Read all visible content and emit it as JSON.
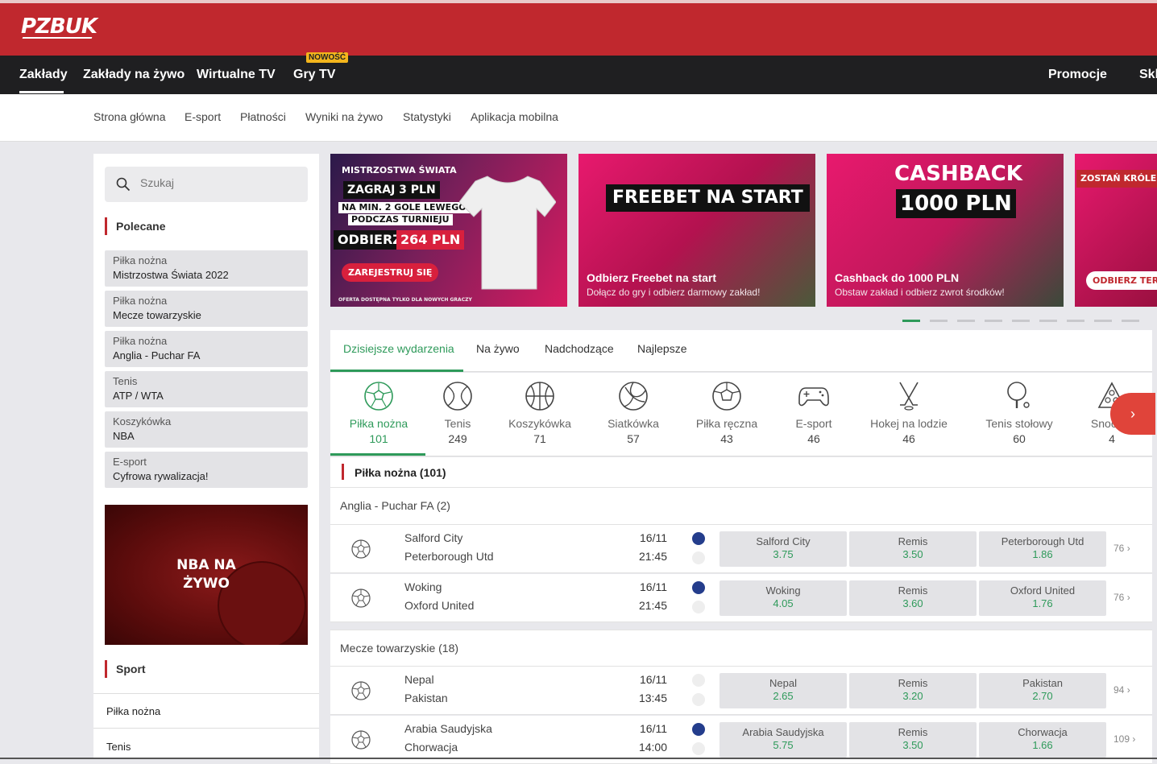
{
  "brand": {
    "logo": "PZBUK",
    "accent": "#c0282e",
    "green": "#2e9a5a"
  },
  "nav": {
    "items": [
      "Zakłady",
      "Zakłady na żywo",
      "Wirtualne TV",
      "Gry TV",
      "Promocje",
      "Skl"
    ],
    "badge": "NOWOŚĆ"
  },
  "subnav": [
    "Strona główna",
    "E-sport",
    "Płatności",
    "Wyniki na żywo",
    "Statystyki",
    "Aplikacja mobilna"
  ],
  "sidebar": {
    "search_placeholder": "Szukaj",
    "recommended_title": "Polecane",
    "recommended": [
      {
        "category": "Piłka nożna",
        "name": "Mistrzostwa Świata 2022"
      },
      {
        "category": "Piłka nożna",
        "name": "Mecze towarzyskie"
      },
      {
        "category": "Piłka nożna",
        "name": "Anglia - Puchar FA"
      },
      {
        "category": "Tenis",
        "name": "ATP / WTA"
      },
      {
        "category": "Koszykówka",
        "name": "NBA"
      },
      {
        "category": "E-sport",
        "name": "Cyfrowa rywalizacja!"
      }
    ],
    "promo_text": "NBA NA ŻYWO",
    "sport_title": "Sport",
    "sport_items": [
      "Piłka nożna",
      "Tenis"
    ]
  },
  "banners": [
    {
      "kicker": "MISTRZOSTWA ŚWIATA",
      "line1": "ZAGRAJ 3 PLN",
      "line2": "NA MIN. 2 GOLE LEWEGO",
      "line3": "PODCZAS TURNIEJU",
      "line4a": "ODBIERZ",
      "line4b": "264 PLN",
      "cta": "ZAREJESTRUJ SIĘ",
      "fine": "OFERTA DOSTĘPNA TYLKO DLA NOWYCH GRACZY"
    },
    {
      "headline": "FREEBET NA START",
      "title": "Odbierz Freebet na start",
      "subtitle": "Dołącz do gry i odbierz darmowy zakład!"
    },
    {
      "headline1": "CASHBACK",
      "headline2": "1000 PLN",
      "title": "Cashback do 1000 PLN",
      "subtitle": "Obstaw zakład i odbierz zwrot środków!"
    },
    {
      "headline": "ZOSTAŃ KRÓLEM",
      "cta": "ODBIERZ TERAZ"
    }
  ],
  "tabs": [
    "Dzisiejsze wydarzenia",
    "Na żywo",
    "Nadchodzące",
    "Najlepsze"
  ],
  "sports": [
    {
      "name": "Piłka nożna",
      "count": "101"
    },
    {
      "name": "Tenis",
      "count": "249"
    },
    {
      "name": "Koszykówka",
      "count": "71"
    },
    {
      "name": "Siatkówka",
      "count": "57"
    },
    {
      "name": "Piłka ręczna",
      "count": "43"
    },
    {
      "name": "E-sport",
      "count": "46"
    },
    {
      "name": "Hokej na lodzie",
      "count": "46"
    },
    {
      "name": "Tenis stołowy",
      "count": "60"
    },
    {
      "name": "Snooker",
      "count": "4"
    }
  ],
  "section_title": "Piłka nożna  (101)",
  "leagues": [
    {
      "name": "Anglia - Puchar FA (2)"
    },
    {
      "name": "Mecze towarzyskie (18)"
    }
  ],
  "matches": [
    {
      "home": "Salford City",
      "away": "Peterborough Utd",
      "date": "16/11",
      "time": "21:45",
      "stats": true,
      "odds": [
        {
          "label": "Salford City",
          "value": "3.75"
        },
        {
          "label": "Remis",
          "value": "3.50"
        },
        {
          "label": "Peterborough Utd",
          "value": "1.86"
        }
      ],
      "more": "76"
    },
    {
      "home": "Woking",
      "away": "Oxford United",
      "date": "16/11",
      "time": "21:45",
      "stats": true,
      "odds": [
        {
          "label": "Woking",
          "value": "4.05"
        },
        {
          "label": "Remis",
          "value": "3.60"
        },
        {
          "label": "Oxford United",
          "value": "1.76"
        }
      ],
      "more": "76"
    },
    {
      "home": "Nepal",
      "away": "Pakistan",
      "date": "16/11",
      "time": "13:45",
      "stats": false,
      "odds": [
        {
          "label": "Nepal",
          "value": "2.65"
        },
        {
          "label": "Remis",
          "value": "3.20"
        },
        {
          "label": "Pakistan",
          "value": "2.70"
        }
      ],
      "more": "94"
    },
    {
      "home": "Arabia Saudyjska",
      "away": "Chorwacja",
      "date": "16/11",
      "time": "14:00",
      "stats": true,
      "odds": [
        {
          "label": "Arabia Saudyjska",
          "value": "5.75"
        },
        {
          "label": "Remis",
          "value": "3.50"
        },
        {
          "label": "Chorwacja",
          "value": "1.66"
        }
      ],
      "more": "109"
    }
  ]
}
